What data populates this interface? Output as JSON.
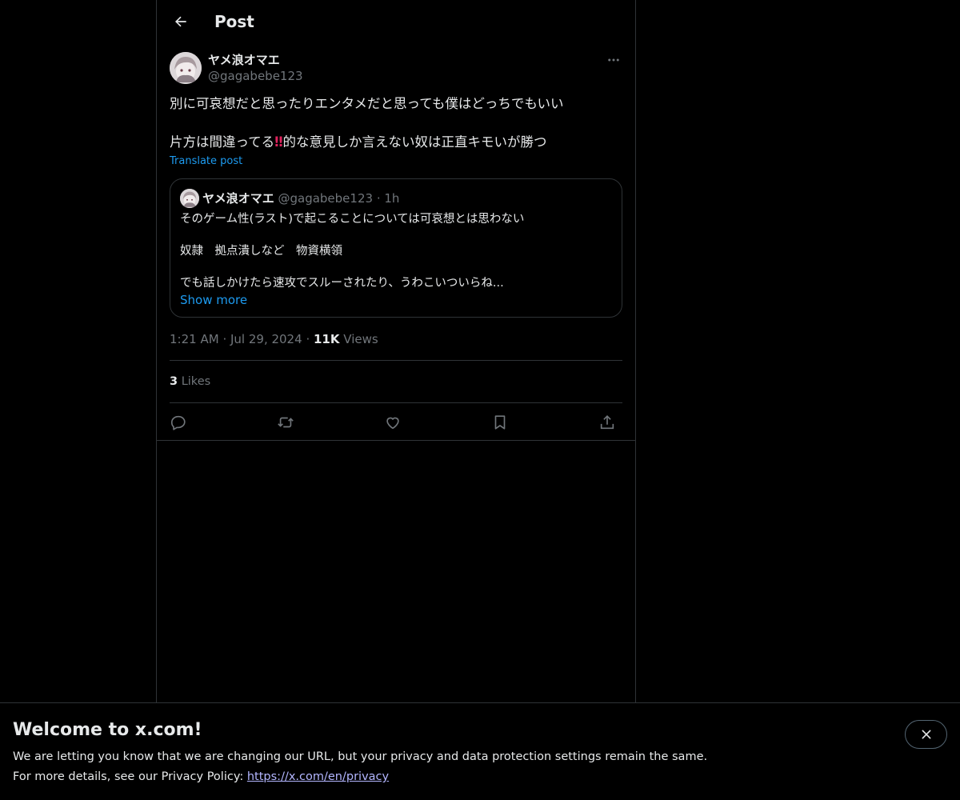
{
  "header": {
    "title": "Post"
  },
  "post": {
    "author_name": "ヤメ浪オマエ",
    "author_handle": "@gagabebe123",
    "line1": "別に可哀想だと思ったりエンタメだと思っても僕はどっちでもいい",
    "line2_before": "片方は間違ってる",
    "line2_emoji": "‼",
    "line2_after": "的な意見しか言えない奴は正直キモいが勝つ",
    "translate_label": "Translate post",
    "time": "1:21 AM",
    "date": "Jul 29, 2024",
    "views_count": "11K",
    "views_label": "Views",
    "likes_count": "3",
    "likes_label": "Likes"
  },
  "quote": {
    "author_name": "ヤメ浪オマエ",
    "author_handle": "@gagabebe123",
    "age": "1h",
    "line1": "そのゲーム性(ラスト)で起こることについては可哀想とは思わない",
    "line2": "奴隷　拠点潰しなど　物資横領",
    "line3": "でも話しかけたら速攻でスルーされたり、うわこいついらね...",
    "show_more": "Show more"
  },
  "banner": {
    "title": "Welcome to x.com!",
    "line1": "We are letting you know that we are changing our URL, but your privacy and data protection settings remain the same.",
    "line2_prefix": "For more details, see our Privacy Policy: ",
    "link_text": "https://x.com/en/privacy"
  },
  "icons": {
    "back": "arrow-left-icon",
    "more": "more-horizontal-icon",
    "reply": "reply-icon",
    "repost": "repost-icon",
    "like": "heart-icon",
    "bookmark": "bookmark-icon",
    "share": "share-icon",
    "close": "close-icon"
  },
  "colors": {
    "background": "#000000",
    "text": "#e7e9ea",
    "muted": "#71767b",
    "accent": "#1d9bf0",
    "border": "#2f3336",
    "link": "#b3b6ff"
  }
}
